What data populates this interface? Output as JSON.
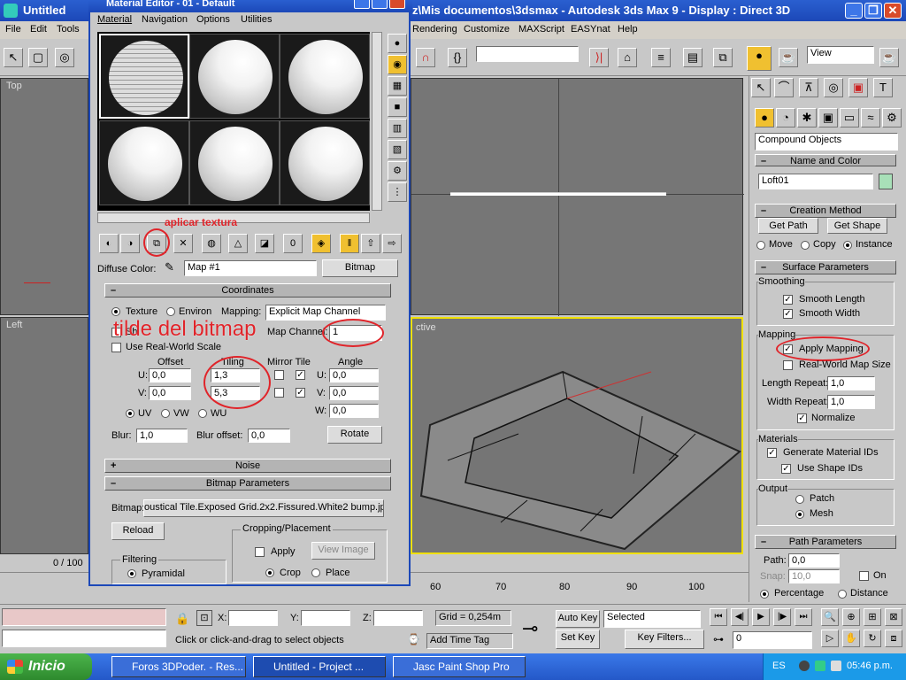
{
  "main_title": "Untitled",
  "main_title_right": "z\\Mis documentos\\3dsmax     - Autodesk 3ds Max 9     - Display : Direct 3D",
  "main_menu": [
    "File",
    "Edit",
    "Tools"
  ],
  "main_menu_right": [
    "Rendering",
    "Customize",
    "MAXScript",
    "EASYnat",
    "Help"
  ],
  "toolbar": {
    "view_select": "View"
  },
  "viewports": {
    "top": "Top",
    "left": "Left",
    "perspective": "ctive"
  },
  "timeline": {
    "frame": "0 / 100",
    "ticks": [
      "60",
      "70",
      "80",
      "90",
      "100"
    ]
  },
  "material_editor": {
    "title": "Material Editor - 01 - Default",
    "menu": [
      "Material",
      "Navigation",
      "Options",
      "Utilities"
    ],
    "annotation_apply": "aplicar textura",
    "annotation_tilde": "tilde del bitmap",
    "diffuse_label": "Diffuse Color:",
    "map_name": "Map #1",
    "map_type": "Bitmap",
    "coordinates": {
      "header": "Coordinates",
      "texture": "Texture",
      "environ": "Environ",
      "mapping_label": "Mapping:",
      "mapping_value": "Explicit Map Channel",
      "show_map": "Sh",
      "map_channel_label": "Map Channel:",
      "map_channel_value": "1",
      "real_world": "Use Real-World Scale",
      "offset": "Offset",
      "tiling": "Tiling",
      "mirror_tile": "Mirror Tile",
      "angle": "Angle",
      "u": "U:",
      "v": "V:",
      "w": "W:",
      "u_offset": "0,0",
      "v_offset": "0,0",
      "u_tiling": "1,3",
      "v_tiling": "5,3",
      "u_angle": "0,0",
      "v_angle": "0,0",
      "w_angle": "0,0",
      "uv": "UV",
      "vw": "VW",
      "wu": "WU",
      "blur_label": "Blur:",
      "blur": "1,0",
      "blur_offset_label": "Blur offset:",
      "blur_offset": "0,0",
      "rotate": "Rotate"
    },
    "noise_header": "Noise",
    "bitmap_header": "Bitmap Parameters",
    "bitmap_label": "Bitmap:",
    "bitmap_path": "oustical Tile.Exposed Grid.2x2.Fissured.White2 bump.jpg",
    "reload": "Reload",
    "cropping": "Cropping/Placement",
    "apply": "Apply",
    "view_image": "View Image",
    "crop": "Crop",
    "place": "Place",
    "filtering": "Filtering",
    "pyramidal": "Pyramidal"
  },
  "command_panel": {
    "category": "Compound Objects",
    "name_color_header": "Name and Color",
    "object_name": "Loft01",
    "object_color": "#a8e0b8",
    "creation_header": "Creation Method",
    "get_path": "Get Path",
    "get_shape": "Get Shape",
    "move": "Move",
    "copy": "Copy",
    "instance": "Instance",
    "surface_header": "Surface Parameters",
    "smoothing": "Smoothing",
    "smooth_length": "Smooth Length",
    "smooth_width": "Smooth Width",
    "mapping": "Mapping",
    "apply_mapping": "Apply Mapping",
    "real_world_map": "Real-World Map Size",
    "length_repeat_label": "Length Repeat:",
    "length_repeat": "1,0",
    "width_repeat_label": "Width Repeat:",
    "width_repeat": "1,0",
    "normalize": "Normalize",
    "materials": "Materials",
    "gen_mat_ids": "Generate Material IDs",
    "use_shape_ids": "Use Shape IDs",
    "output": "Output",
    "patch": "Patch",
    "mesh": "Mesh",
    "path_header": "Path Parameters",
    "path_label": "Path:",
    "path_value": "0,0",
    "snap_label": "Snap:",
    "snap_value": "10,0",
    "on": "On",
    "percentage": "Percentage",
    "distance": "Distance"
  },
  "status": {
    "x_label": "X:",
    "y_label": "Y:",
    "z_label": "Z:",
    "grid": "Grid = 0,254m",
    "prompt": "Click or click-and-drag to select objects",
    "add_time_tag": "Add Time Tag",
    "auto_key": "Auto Key",
    "set_key": "Set Key",
    "selected": "Selected",
    "key_filters": "Key Filters...",
    "frame": "0"
  },
  "taskbar": {
    "start": "Inicio",
    "items": [
      "Foros 3DPoder. - Res...",
      "Untitled     - Project ...",
      "Jasc Paint Shop Pro"
    ],
    "lang": "ES",
    "clock": "05:46 p.m."
  }
}
